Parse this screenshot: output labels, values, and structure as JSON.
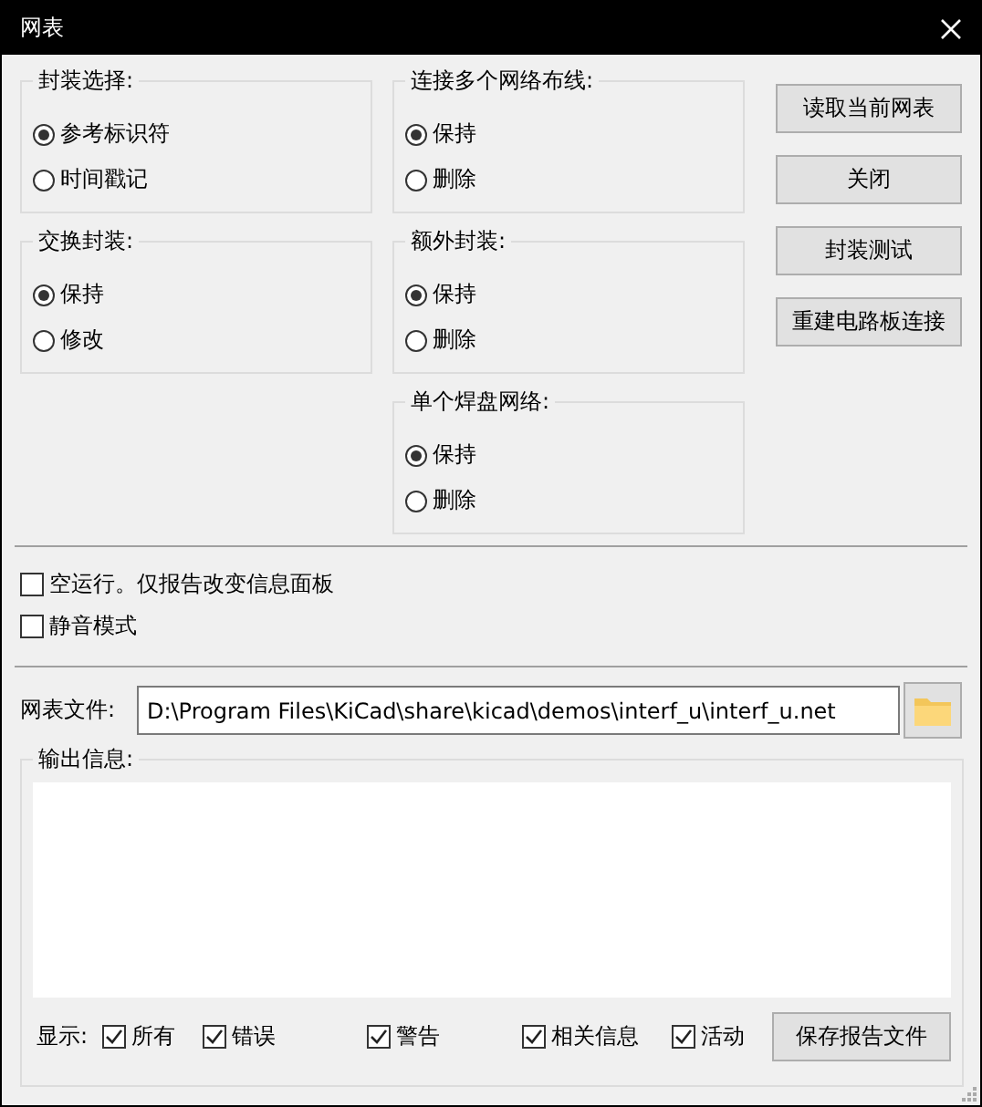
{
  "window": {
    "title": "网表"
  },
  "option_columns": [
    {
      "groups": [
        {
          "title": "封装选择:",
          "options": [
            {
              "label": "参考标识符",
              "selected": true
            },
            {
              "label": "时间戳记",
              "selected": false
            }
          ]
        },
        {
          "title": "交换封装:",
          "options": [
            {
              "label": "保持",
              "selected": true
            },
            {
              "label": "修改",
              "selected": false
            }
          ]
        }
      ]
    },
    {
      "groups": [
        {
          "title": "连接多个网络布线:",
          "options": [
            {
              "label": "保持",
              "selected": true
            },
            {
              "label": "删除",
              "selected": false
            }
          ]
        },
        {
          "title": "额外封装:",
          "options": [
            {
              "label": "保持",
              "selected": true
            },
            {
              "label": "删除",
              "selected": false
            }
          ]
        },
        {
          "title": "单个焊盘网络:",
          "options": [
            {
              "label": "保持",
              "selected": true
            },
            {
              "label": "删除",
              "selected": false
            }
          ]
        }
      ]
    }
  ],
  "buttons": [
    "读取当前网表",
    "关闭",
    "封装测试",
    "重建电路板连接"
  ],
  "options": [
    {
      "label": "空运行。仅报告改变信息面板",
      "checked": false
    },
    {
      "label": "静音模式",
      "checked": false
    }
  ],
  "netlist_file": {
    "label": "网表文件:",
    "value": "D:\\Program Files\\KiCad\\share\\kicad\\demos\\interf_u\\interf_u.net"
  },
  "output": {
    "title": "输出信息:",
    "show_label": "显示:",
    "filters": [
      {
        "label": "所有",
        "checked": true
      },
      {
        "label": "错误",
        "checked": true
      },
      {
        "label": "警告",
        "checked": true
      },
      {
        "label": "相关信息",
        "checked": true
      },
      {
        "label": "活动",
        "checked": true
      }
    ],
    "save_button": "保存报告文件"
  }
}
